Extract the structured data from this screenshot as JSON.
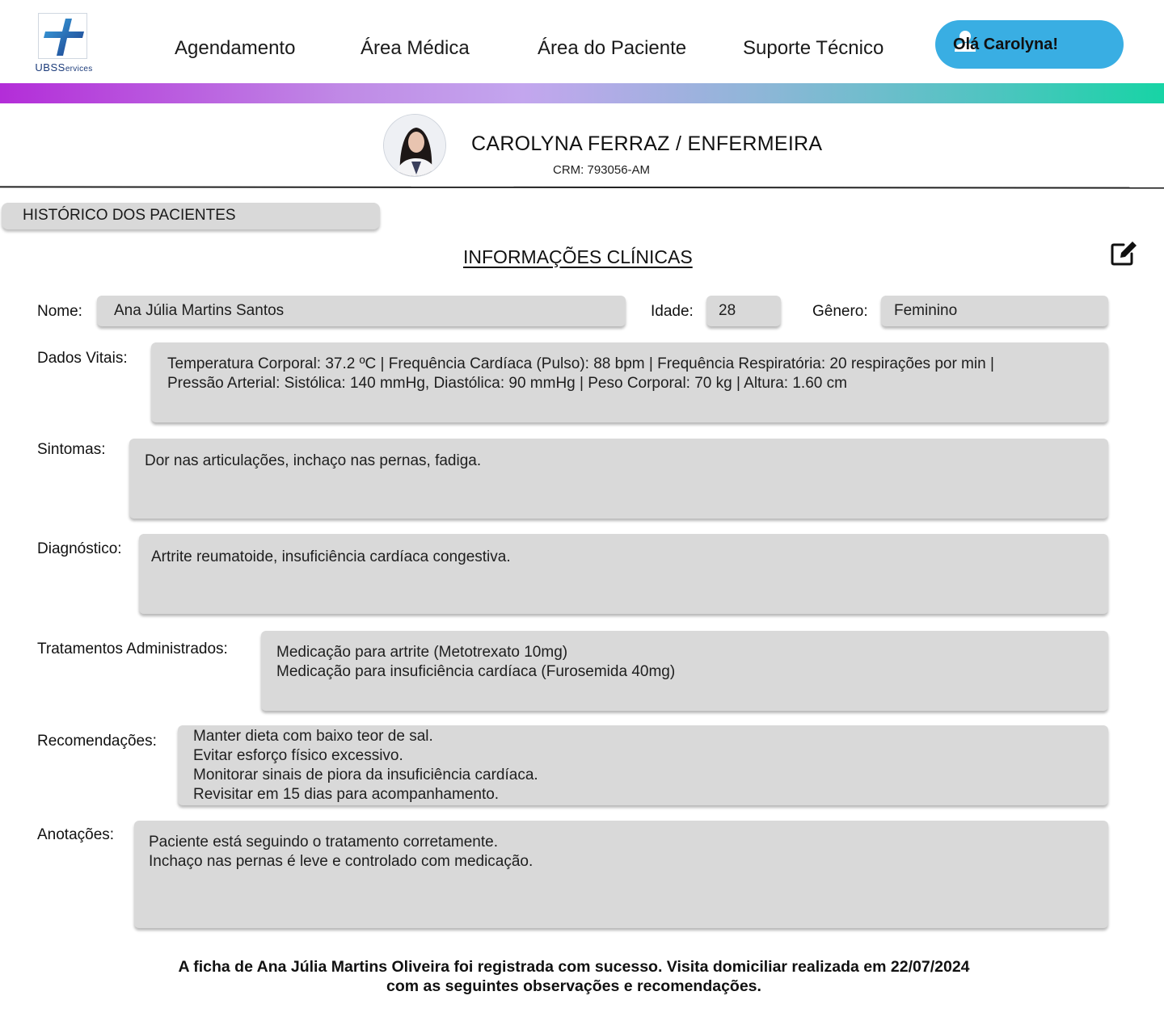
{
  "brand": {
    "name_main": "UBS",
    "name_small": "ervices",
    "name_s": "S"
  },
  "nav": [
    {
      "label": "Agendamento"
    },
    {
      "label": "Área Médica"
    },
    {
      "label": "Área do Paciente"
    },
    {
      "label": "Suporte Técnico"
    }
  ],
  "user_button": {
    "label": "Olá Carolyna!",
    "icon": "user-icon"
  },
  "colors": {
    "accent": "#39aee3",
    "field_bg": "#d9d9d9",
    "gradient_start": "#b32dd8",
    "gradient_end": "#17d4a5"
  },
  "profile": {
    "name": "CAROLYNA FERRAZ / ENFERMEIRA",
    "crm": "CRM: 793056-AM"
  },
  "history_button": {
    "label": "HISTÓRICO DOS PACIENTES"
  },
  "section": {
    "title": "INFORMAÇÕES CLÍNICAS",
    "edit_icon": "edit-icon"
  },
  "patient": {
    "name_label": "Nome:",
    "name": "Ana Júlia Martins Santos",
    "age_label": "Idade:",
    "age": "28",
    "gender_label": "Gênero:",
    "gender": "Feminino"
  },
  "clinical": {
    "vitals_label": "Dados Vitais:",
    "vitals": "Temperatura Corporal: 37.2 ºC | Frequência Cardíaca (Pulso): 88 bpm | Frequência Respiratória: 20 respirações por min |\nPressão Arterial: Sistólica: 140 mmHg, Diastólica: 90 mmHg | Peso Corporal: 70 kg | Altura: 1.60 cm",
    "symptoms_label": "Sintomas:",
    "symptoms": "Dor nas articulações, inchaço nas pernas, fadiga.",
    "diagnosis_label": "Diagnóstico:",
    "diagnosis": "Artrite reumatoide, insuficiência cardíaca congestiva.",
    "treatments_label": "Tratamentos Administrados:",
    "treatments": "Medicação para artrite (Metotrexato 10mg)\nMedicação para insuficiência cardíaca (Furosemida 40mg)",
    "recommendations_label": "Recomendações:",
    "recommendations": "Manter dieta com baixo teor de sal.\nEvitar esforço físico excessivo.\nMonitorar sinais de piora da insuficiência cardíaca.\nRevisitar em 15 dias para acompanhamento.",
    "notes_label": "Anotações:",
    "notes": "Paciente está seguindo o tratamento corretamente.\nInchaço nas pernas é leve e controlado com medicação."
  },
  "footer": {
    "message": "A ficha de Ana Júlia Martins Oliveira foi registrada com sucesso. Visita domiciliar realizada em 22/07/2024 com as seguintes observações e recomendações."
  }
}
